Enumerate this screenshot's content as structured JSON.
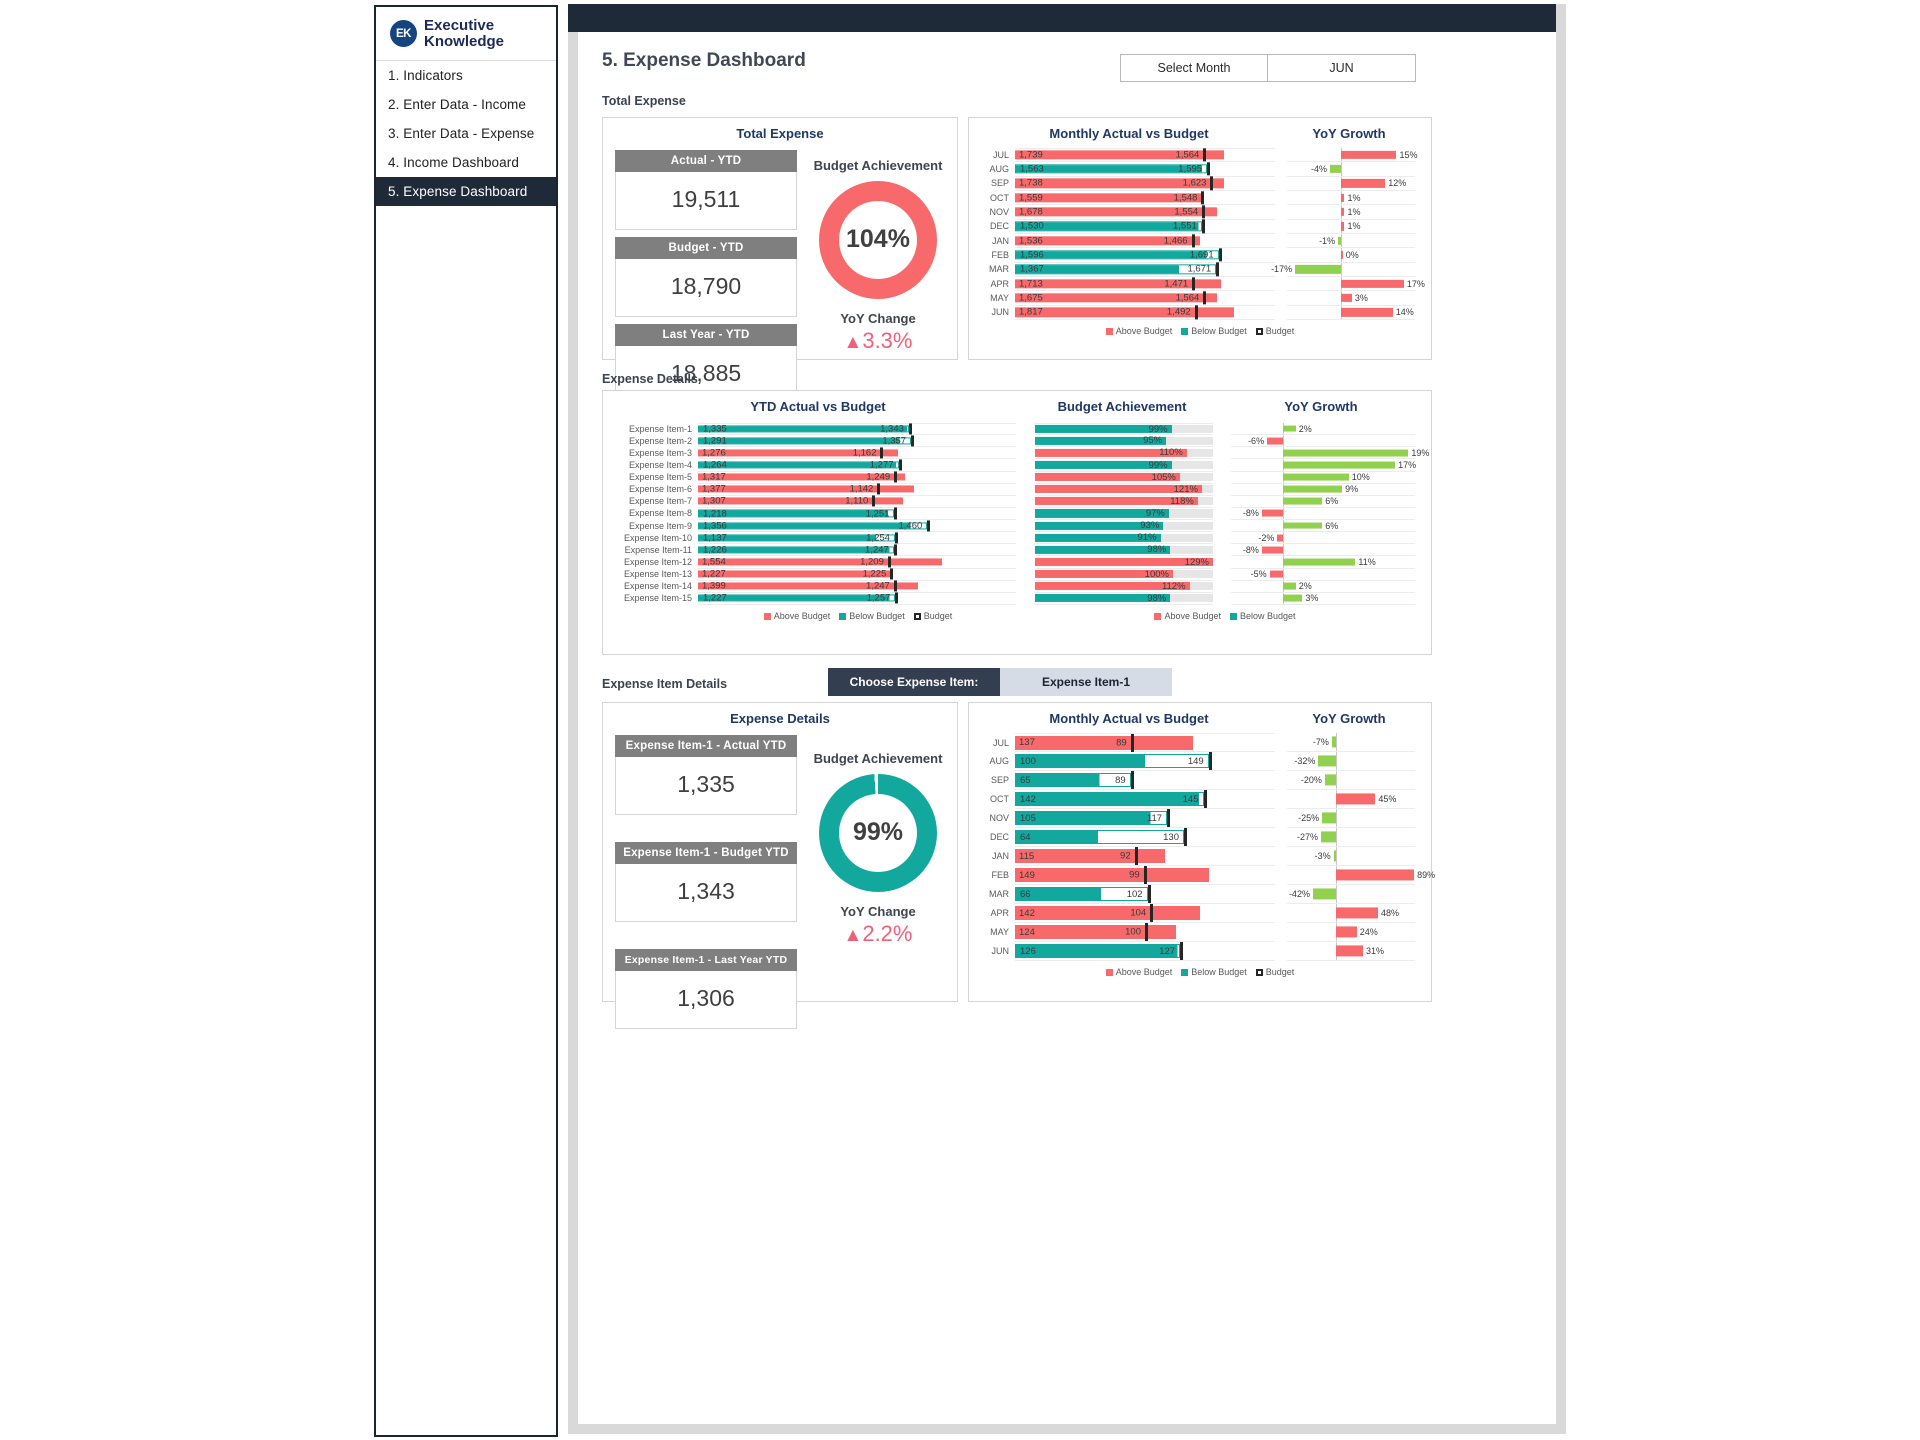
{
  "brand": {
    "initials": "EK",
    "line1": "Executive",
    "line2": "Knowledge"
  },
  "sidebar": {
    "items": [
      {
        "label": "1. Indicators",
        "active": false
      },
      {
        "label": "2. Enter Data - Income",
        "active": false
      },
      {
        "label": "3. Enter Data - Expense",
        "active": false
      },
      {
        "label": "4. Income Dashboard",
        "active": false
      },
      {
        "label": "5. Expense Dashboard",
        "active": true
      }
    ]
  },
  "header": {
    "title": "5. Expense Dashboard",
    "month_label": "Select Month",
    "month_value": "JUN"
  },
  "colors": {
    "above_budget": "#f8696b",
    "below_budget": "#13a89e",
    "budget_marker": "#262626",
    "growth_positive_green": "#92d050",
    "growth_negative_red": "#f8696b",
    "header_gray": "#7f7f7f",
    "title_blue": "#1f3864",
    "sidebar_active": "#1f2a38",
    "chooser_label": "#333f50",
    "chooser_value": "#d6dce5"
  },
  "sections": {
    "total_expense_label": "Total Expense",
    "expense_details_label": "Expense Details",
    "expense_item_details_label": "Expense Item Details"
  },
  "total_expense_panel": {
    "title": "Total Expense",
    "kpis": [
      {
        "label": "Actual - YTD",
        "value": "19,511"
      },
      {
        "label": "Budget - YTD",
        "value": "18,790"
      },
      {
        "label": "Last Year - YTD",
        "value": "18,885"
      }
    ],
    "gauge": {
      "title": "Budget Achievement",
      "value": "104%",
      "percent": 104,
      "color": "#f8696b"
    },
    "yoy": {
      "title": "YoY Change",
      "value": "3.3%",
      "arrow": "▲",
      "color": "#f0607a"
    }
  },
  "monthly_panel": {
    "title_bars": "Monthly Actual vs Budget",
    "title_growth": "YoY Growth",
    "legend": [
      "Above Budget",
      "Below Budget",
      "Budget"
    ]
  },
  "chart_data": [
    {
      "type": "bar",
      "id": "total-monthly-actual-vs-budget",
      "title": "Monthly Actual vs Budget",
      "orientation": "horizontal",
      "categories": [
        "JUL",
        "AUG",
        "SEP",
        "OCT",
        "NOV",
        "DEC",
        "JAN",
        "FEB",
        "MAR",
        "APR",
        "MAY",
        "JUN"
      ],
      "series": [
        {
          "name": "Actual",
          "values": [
            1739,
            1563,
            1738,
            1559,
            1678,
            1530,
            1536,
            1596,
            1367,
            1713,
            1675,
            1817
          ]
        },
        {
          "name": "Budget",
          "values": [
            1564,
            1595,
            1623,
            1548,
            1554,
            1551,
            1466,
            1691,
            1671,
            1471,
            1564,
            1492
          ]
        }
      ],
      "above_budget": [
        true,
        false,
        true,
        true,
        true,
        false,
        true,
        false,
        false,
        true,
        true,
        true
      ],
      "xmax": 1900,
      "ylabel": "",
      "xlabel": "",
      "grid": false
    },
    {
      "type": "bar",
      "id": "total-monthly-yoy-growth",
      "title": "YoY Growth",
      "orientation": "horizontal",
      "categories": [
        "JUL",
        "AUG",
        "SEP",
        "OCT",
        "NOV",
        "DEC",
        "JAN",
        "FEB",
        "MAR",
        "APR",
        "MAY",
        "JUN"
      ],
      "values": [
        15,
        -4,
        12,
        1,
        1,
        1,
        -1,
        0,
        -17,
        17,
        3,
        14
      ],
      "labels": [
        "15%",
        "-4%",
        "12%",
        "1%",
        "1%",
        "1%",
        "-1%",
        "0%",
        "-17%",
        "17%",
        "3%",
        "14%"
      ],
      "positive_color": "#f8696b",
      "negative_color": "#92d050",
      "xlim": [
        -20,
        20
      ]
    },
    {
      "type": "bar",
      "id": "expense-items-ytd-actual-vs-budget",
      "title": "YTD Actual vs Budget",
      "orientation": "horizontal",
      "categories": [
        "Expense Item-1",
        "Expense Item-2",
        "Expense Item-3",
        "Expense Item-4",
        "Expense Item-5",
        "Expense Item-6",
        "Expense Item-7",
        "Expense Item-8",
        "Expense Item-9",
        "Expense Item-10",
        "Expense Item-11",
        "Expense Item-12",
        "Expense Item-13",
        "Expense Item-14",
        "Expense Item-15"
      ],
      "series": [
        {
          "name": "Actual",
          "values": [
            1335,
            1291,
            1276,
            1264,
            1317,
            1377,
            1307,
            1218,
            1356,
            1137,
            1226,
            1554,
            1227,
            1399,
            1227
          ]
        },
        {
          "name": "Budget",
          "values": [
            1343,
            1357,
            1162,
            1277,
            1249,
            1142,
            1110,
            1251,
            1460,
            1254,
            1247,
            1209,
            1225,
            1247,
            1257
          ]
        }
      ],
      "above_budget": [
        false,
        false,
        true,
        false,
        true,
        true,
        true,
        false,
        false,
        false,
        false,
        true,
        true,
        true,
        false
      ],
      "xmax": 1620
    },
    {
      "type": "bar",
      "id": "expense-items-budget-achievement",
      "title": "Budget Achievement",
      "orientation": "horizontal",
      "categories": [
        "Expense Item-1",
        "Expense Item-2",
        "Expense Item-3",
        "Expense Item-4",
        "Expense Item-5",
        "Expense Item-6",
        "Expense Item-7",
        "Expense Item-8",
        "Expense Item-9",
        "Expense Item-10",
        "Expense Item-11",
        "Expense Item-12",
        "Expense Item-13",
        "Expense Item-14",
        "Expense Item-15"
      ],
      "values": [
        99,
        95,
        110,
        99,
        105,
        121,
        118,
        97,
        93,
        91,
        98,
        129,
        100,
        112,
        98
      ],
      "labels": [
        "99%",
        "95%",
        "110%",
        "99%",
        "105%",
        "121%",
        "118%",
        "97%",
        "93%",
        "91%",
        "98%",
        "129%",
        "100%",
        "112%",
        "98%"
      ],
      "above_budget": [
        false,
        false,
        true,
        false,
        true,
        true,
        true,
        false,
        false,
        false,
        false,
        true,
        true,
        true,
        false
      ],
      "xmax": 129
    },
    {
      "type": "bar",
      "id": "expense-items-yoy-growth",
      "title": "YoY Growth",
      "orientation": "horizontal",
      "categories": [
        "Expense Item-1",
        "Expense Item-2",
        "Expense Item-3",
        "Expense Item-4",
        "Expense Item-5",
        "Expense Item-6",
        "Expense Item-7",
        "Expense Item-8",
        "Expense Item-9",
        "Expense Item-10",
        "Expense Item-11",
        "Expense Item-12",
        "Expense Item-13",
        "Expense Item-14",
        "Expense Item-15"
      ],
      "values": [
        2,
        -6,
        19,
        17,
        10,
        9,
        6,
        -8,
        6,
        -2,
        -8,
        11,
        -5,
        2,
        3
      ],
      "labels": [
        "2%",
        "-6%",
        "19%",
        "17%",
        "10%",
        "9%",
        "6%",
        "-8%",
        "6%",
        "-2%",
        "-8%",
        "11%",
        "-5%",
        "2%",
        "3%"
      ],
      "positive_color": "#92d050",
      "negative_color": "#f8696b",
      "xlim": [
        -20,
        20
      ]
    },
    {
      "type": "bar",
      "id": "item-monthly-actual-vs-budget",
      "title": "Monthly Actual vs Budget",
      "orientation": "horizontal",
      "categories": [
        "JUL",
        "AUG",
        "SEP",
        "OCT",
        "NOV",
        "DEC",
        "JAN",
        "FEB",
        "MAR",
        "APR",
        "MAY",
        "JUN"
      ],
      "series": [
        {
          "name": "Actual",
          "values": [
            137,
            100,
            65,
            142,
            105,
            64,
            115,
            149,
            66,
            142,
            124,
            126
          ]
        },
        {
          "name": "Budget",
          "values": [
            89,
            149,
            89,
            145,
            117,
            130,
            92,
            99,
            102,
            104,
            100,
            127
          ]
        }
      ],
      "above_budget": [
        true,
        false,
        false,
        false,
        false,
        false,
        true,
        true,
        false,
        true,
        true,
        false
      ],
      "xmax": 160
    },
    {
      "type": "bar",
      "id": "item-monthly-yoy-growth",
      "title": "YoY Growth",
      "orientation": "horizontal",
      "categories": [
        "JUL",
        "AUG",
        "SEP",
        "OCT",
        "NOV",
        "DEC",
        "JAN",
        "FEB",
        "MAR",
        "APR",
        "MAY",
        "JUN"
      ],
      "values": [
        -7,
        -32,
        -20,
        45,
        -25,
        -27,
        -3,
        89,
        -42,
        48,
        24,
        31
      ],
      "labels": [
        "-7%",
        "-32%",
        "-20%",
        "45%",
        "-25%",
        "-27%",
        "-3%",
        "89%",
        "-42%",
        "48%",
        "24%",
        "31%"
      ],
      "positive_color": "#f8696b",
      "negative_color": "#92d050",
      "xlim": [
        -90,
        90
      ]
    }
  ],
  "expense_details_panel": {
    "title_bars": "YTD Actual vs Budget",
    "title_achievement": "Budget Achievement",
    "title_growth": "YoY Growth",
    "legend_left": [
      "Above Budget",
      "Below Budget",
      "Budget"
    ],
    "legend_right": [
      "Above Budget",
      "Below Budget"
    ]
  },
  "item_details": {
    "chooser_label": "Choose Expense Item:",
    "chooser_value": "Expense Item-1",
    "panel_title": "Expense Details",
    "kpis": [
      {
        "label": "Expense Item-1 - Actual YTD",
        "value": "1,335"
      },
      {
        "label": "Expense Item-1 - Budget YTD",
        "value": "1,343"
      },
      {
        "label": "Expense Item-1 - Last Year YTD",
        "value": "1,306"
      }
    ],
    "gauge": {
      "title": "Budget Achievement",
      "value": "99%",
      "percent": 99,
      "color": "#13a89e"
    },
    "yoy": {
      "title": "YoY Change",
      "value": "2.2%",
      "arrow": "▲",
      "color": "#f0607a"
    },
    "title_bars": "Monthly Actual vs Budget",
    "title_growth": "YoY Growth",
    "legend": [
      "Above Budget",
      "Below Budget",
      "Budget"
    ]
  }
}
